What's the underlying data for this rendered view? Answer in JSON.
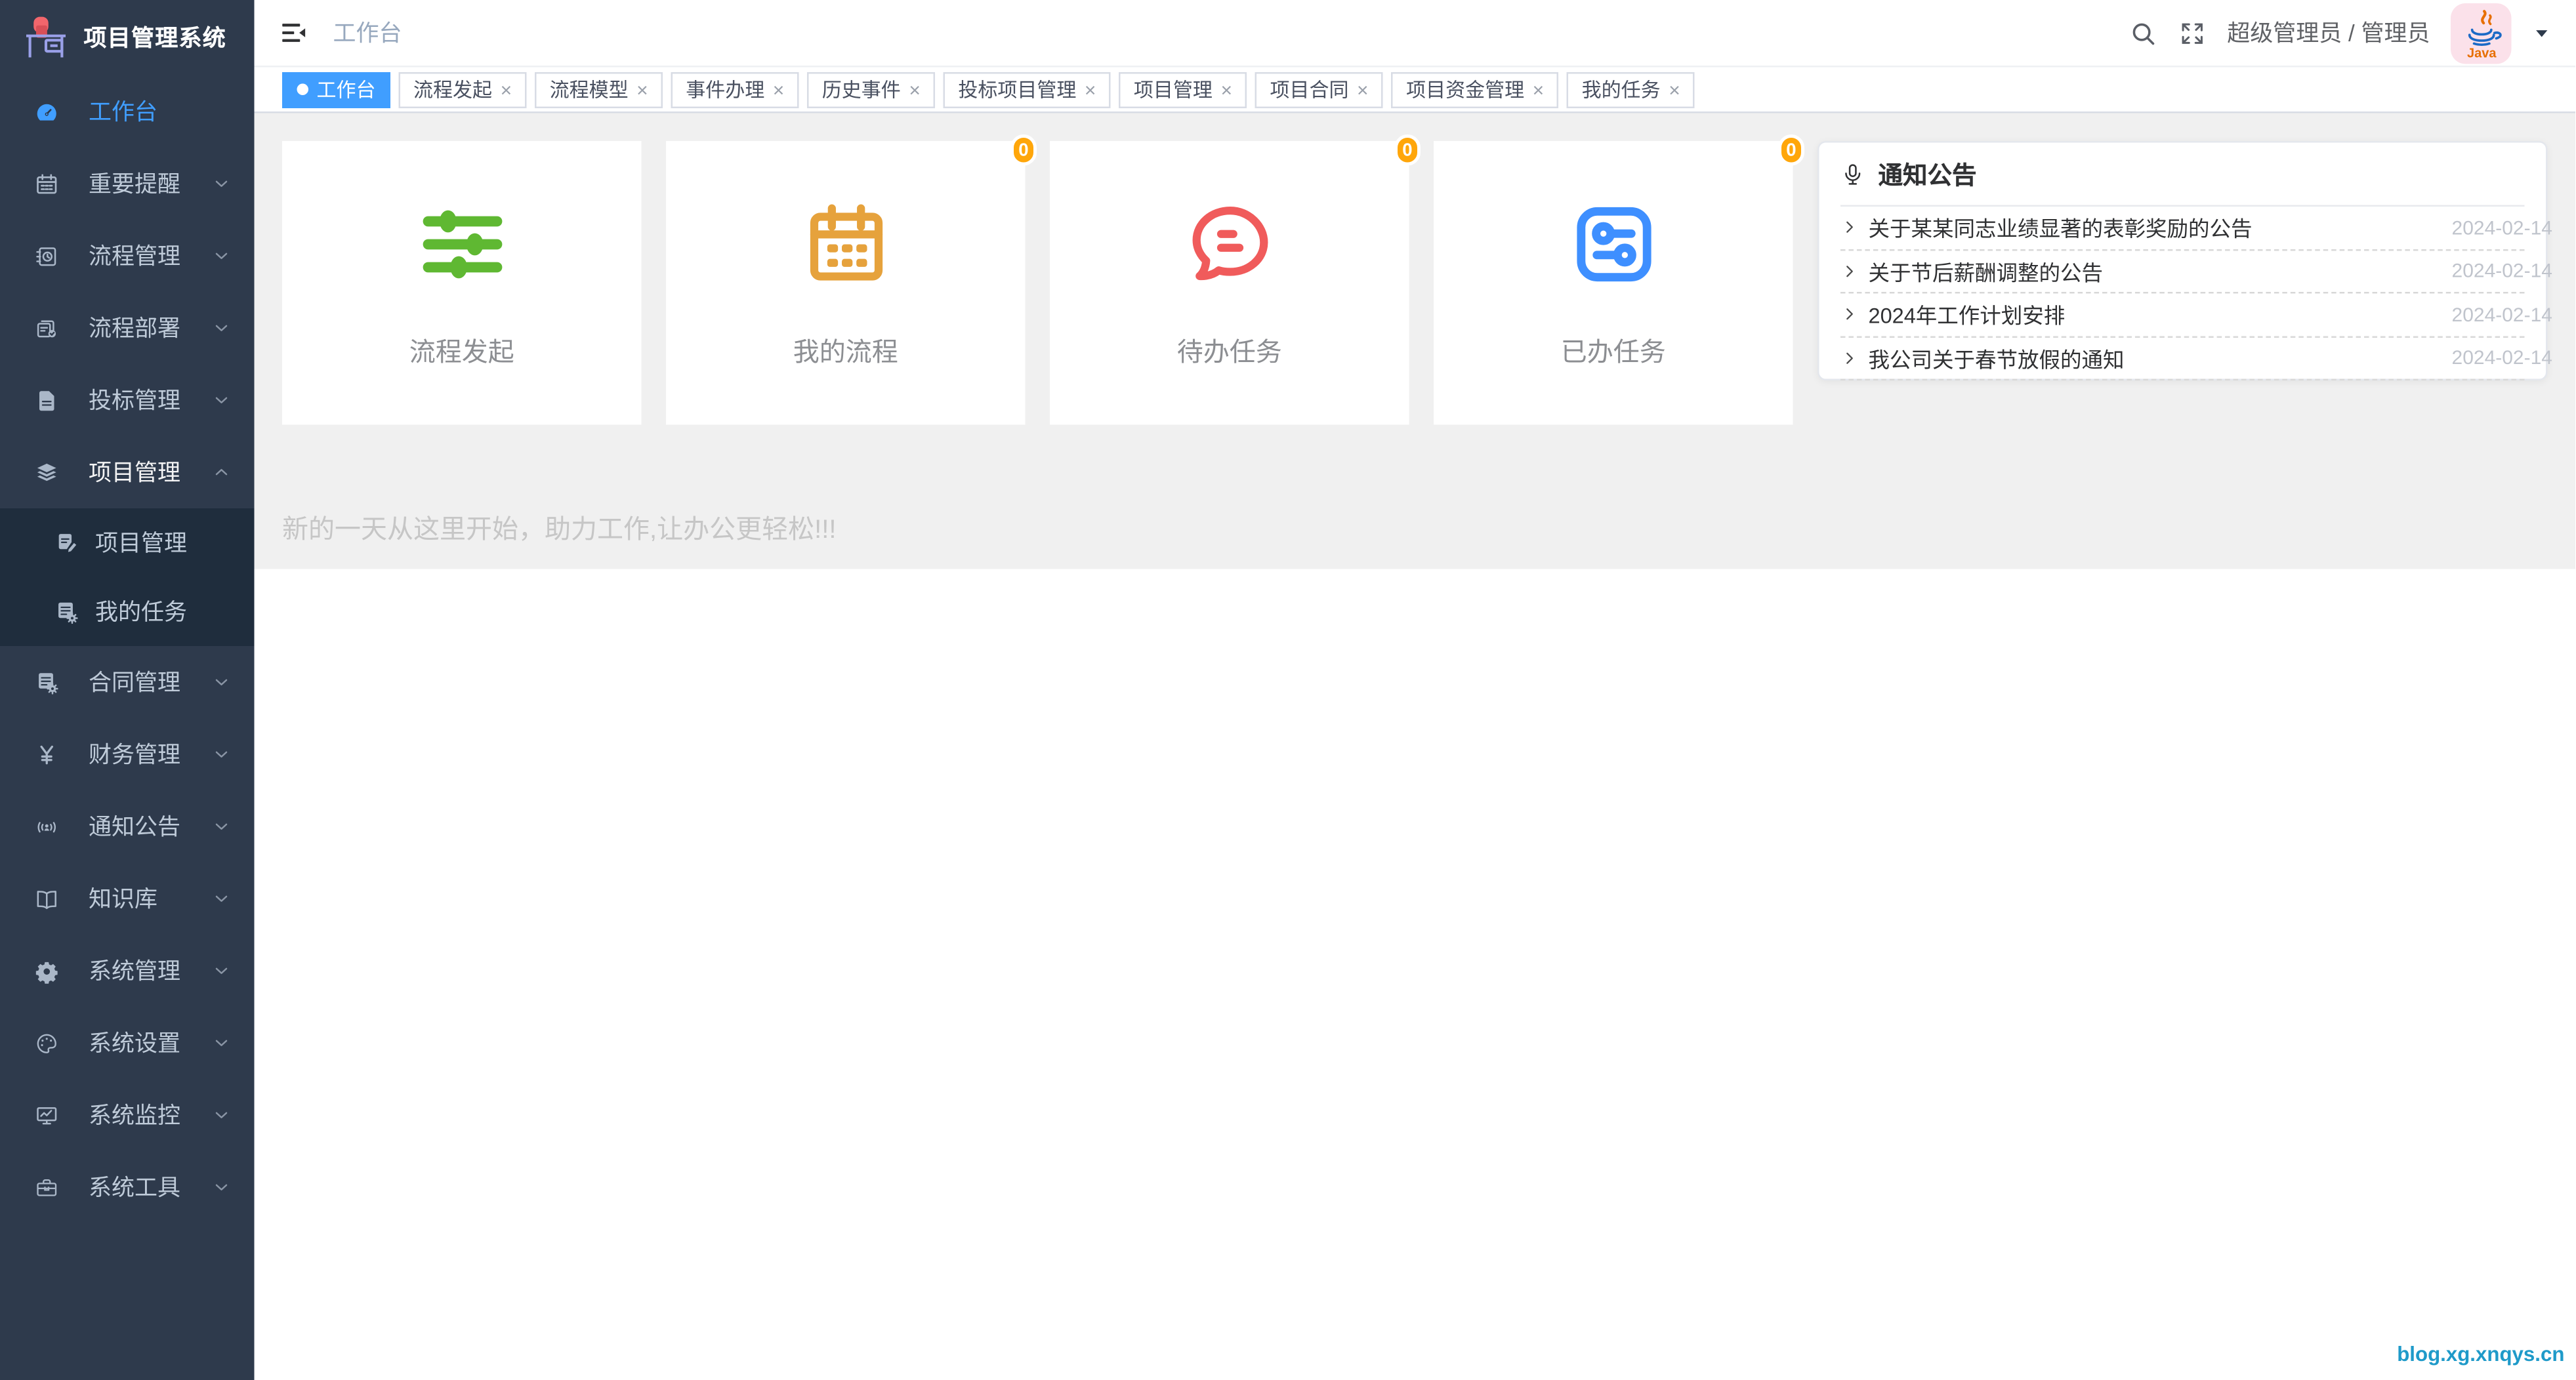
{
  "app": {
    "title": "项目管理系统"
  },
  "header": {
    "breadcrumb": "工作台",
    "user": "超级管理员 / 管理员",
    "avatar_label": "Java"
  },
  "sidebar": {
    "items": [
      {
        "id": "workbench",
        "label": "工作台",
        "icon": "dashboard-icon",
        "active": true,
        "expandable": false
      },
      {
        "id": "important-reminder",
        "label": "重要提醒",
        "icon": "calendar-icon",
        "expandable": true
      },
      {
        "id": "process-management",
        "label": "流程管理",
        "icon": "process-log-icon",
        "expandable": true
      },
      {
        "id": "process-deployment",
        "label": "流程部署",
        "icon": "doc-check-icon",
        "expandable": true
      },
      {
        "id": "bidding-management",
        "label": "投标管理",
        "icon": "document-icon",
        "expandable": true
      },
      {
        "id": "project-management",
        "label": "项目管理",
        "icon": "layers-icon",
        "expandable": true,
        "expanded": true,
        "children": [
          {
            "id": "project-management-sub",
            "label": "项目管理",
            "icon": "doc-edit-icon"
          },
          {
            "id": "my-tasks",
            "label": "我的任务",
            "icon": "doc-gear-icon"
          }
        ]
      },
      {
        "id": "contract-management",
        "label": "合同管理",
        "icon": "doc-gear-icon",
        "expandable": true
      },
      {
        "id": "finance-management",
        "label": "财务管理",
        "icon": "yen-icon",
        "expandable": true
      },
      {
        "id": "notice-announcement",
        "label": "通知公告",
        "icon": "broadcast-icon",
        "expandable": true
      },
      {
        "id": "knowledge-base",
        "label": "知识库",
        "icon": "book-icon",
        "expandable": true
      },
      {
        "id": "system-management",
        "label": "系统管理",
        "icon": "gear-icon",
        "expandable": true
      },
      {
        "id": "system-settings",
        "label": "系统设置",
        "icon": "palette-icon",
        "expandable": true
      },
      {
        "id": "system-monitor",
        "label": "系统监控",
        "icon": "monitor-icon",
        "expandable": true
      },
      {
        "id": "system-tools",
        "label": "系统工具",
        "icon": "toolbox-icon",
        "expandable": true
      }
    ]
  },
  "tabs": [
    {
      "id": "workbench",
      "label": "工作台",
      "active": true,
      "closable": false
    },
    {
      "id": "process-initiate",
      "label": "流程发起",
      "active": false,
      "closable": true
    },
    {
      "id": "process-model",
      "label": "流程模型",
      "active": false,
      "closable": true
    },
    {
      "id": "event-handling",
      "label": "事件办理",
      "active": false,
      "closable": true
    },
    {
      "id": "history-events",
      "label": "历史事件",
      "active": false,
      "closable": true
    },
    {
      "id": "bidding-project-management",
      "label": "投标项目管理",
      "active": false,
      "closable": true
    },
    {
      "id": "project-management",
      "label": "项目管理",
      "active": false,
      "closable": true
    },
    {
      "id": "project-contract",
      "label": "项目合同",
      "active": false,
      "closable": true
    },
    {
      "id": "project-funds-management",
      "label": "项目资金管理",
      "active": false,
      "closable": true
    },
    {
      "id": "my-tasks",
      "label": "我的任务",
      "active": false,
      "closable": true
    }
  ],
  "cards": [
    {
      "id": "process-initiate",
      "label": "流程发起",
      "icon": "sliders-icon",
      "color": "#5FB832",
      "badge": null
    },
    {
      "id": "my-processes",
      "label": "我的流程",
      "icon": "calendar-grid-icon",
      "color": "#E6A23C",
      "badge": "0"
    },
    {
      "id": "todo-tasks",
      "label": "待办任务",
      "icon": "chat-bubble-icon",
      "color": "#F05B5B",
      "badge": "0"
    },
    {
      "id": "done-tasks",
      "label": "已办任务",
      "icon": "sliders-square-icon",
      "color": "#3E8FFF",
      "badge": "0"
    }
  ],
  "notice": {
    "title": "通知公告",
    "items": [
      {
        "text": "关于某某同志业绩显著的表彰奖励的公告",
        "date": "2024-02-14"
      },
      {
        "text": "关于节后薪酬调整的公告",
        "date": "2024-02-14"
      },
      {
        "text": "2024年工作计划安排",
        "date": "2024-02-14"
      },
      {
        "text": "我公司关于春节放假的通知",
        "date": "2024-02-14"
      }
    ]
  },
  "welcome": "新的一天从这里开始，助力工作,让办公更轻松!!!",
  "footer_link": "blog.xg.xnqys.cn",
  "ui": {
    "close_glyph": "×"
  },
  "colors": {
    "sidebar_bg": "#2e3a4c",
    "submenu_bg": "#1f2d3d",
    "accent_blue": "#409eff",
    "card_green": "#5FB832",
    "card_orange": "#E6A23C",
    "card_red": "#F05B5B",
    "card_blue": "#3E8FFF",
    "badge_orange": "#ffa60a",
    "link_blue": "#1f9ac9"
  }
}
